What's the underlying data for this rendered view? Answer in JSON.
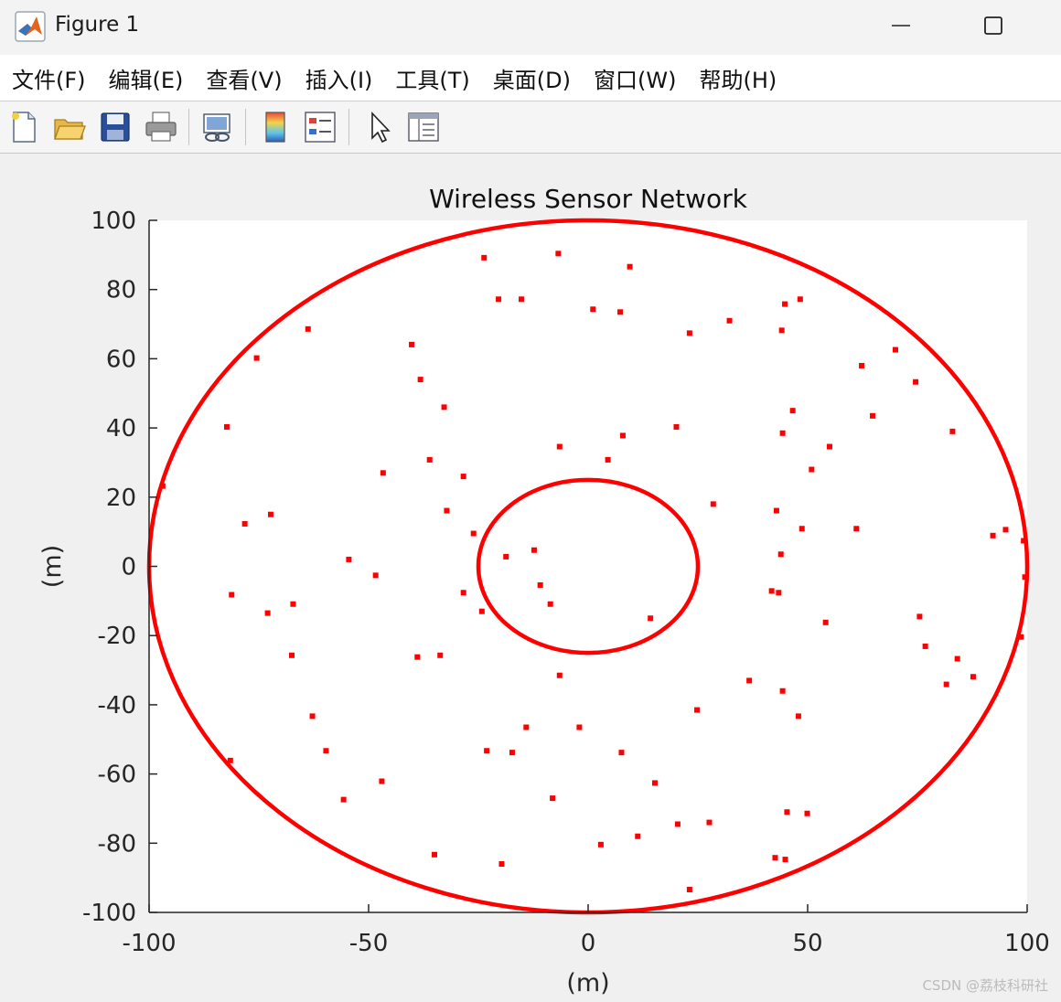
{
  "window": {
    "title": "Figure 1",
    "minimize_icon": "minimize-icon",
    "maximize_icon": "maximize-icon"
  },
  "menu": [
    "文件(F)",
    "编辑(E)",
    "查看(V)",
    "插入(I)",
    "工具(T)",
    "桌面(D)",
    "窗口(W)",
    "帮助(H)"
  ],
  "toolbar": [
    "new-figure-icon",
    "open-file-icon",
    "save-icon",
    "print-icon",
    "link-plot-icon",
    "colorbar-icon",
    "legend-icon",
    "pointer-icon",
    "property-inspector-icon"
  ],
  "watermark": "CSDN @荔枝科研社",
  "colors": {
    "series": "#ff0000",
    "axes": "#262626",
    "plot_bg": "#ffffff",
    "figure_bg": "#f0f0f0"
  },
  "chart_data": {
    "type": "scatter",
    "title": "Wireless Sensor Network",
    "xlabel": "(m)",
    "ylabel": "(m)",
    "xlim": [
      -100,
      100
    ],
    "ylim": [
      -100,
      100
    ],
    "xticks": [
      -100,
      -50,
      0,
      50,
      100
    ],
    "yticks": [
      -100,
      -80,
      -60,
      -40,
      -20,
      0,
      20,
      40,
      60,
      80,
      100
    ],
    "grid": false,
    "circles": [
      {
        "cx": 0,
        "cy": 0,
        "r": 100
      },
      {
        "cx": 0,
        "cy": 0,
        "r": 25
      }
    ],
    "points": [
      [
        -23.7,
        89.2
      ],
      [
        -6.8,
        90.4
      ],
      [
        9.5,
        86.6
      ],
      [
        -20.4,
        77.2
      ],
      [
        -15.2,
        77.2
      ],
      [
        1.1,
        74.3
      ],
      [
        7.3,
        73.5
      ],
      [
        44.8,
        75.8
      ],
      [
        48.3,
        77.2
      ],
      [
        -63.8,
        68.6
      ],
      [
        -40.2,
        64.1
      ],
      [
        23.1,
        67.4
      ],
      [
        32.2,
        71.0
      ],
      [
        44.1,
        68.2
      ],
      [
        -75.5,
        60.2
      ],
      [
        -38.2,
        54.0
      ],
      [
        62.3,
        58.0
      ],
      [
        70.0,
        62.6
      ],
      [
        74.6,
        53.3
      ],
      [
        -32.8,
        46.0
      ],
      [
        46.6,
        45.0
      ],
      [
        64.8,
        43.5
      ],
      [
        -82.3,
        40.3
      ],
      [
        20.1,
        40.3
      ],
      [
        7.9,
        37.8
      ],
      [
        44.3,
        38.5
      ],
      [
        83.0,
        39.0
      ],
      [
        -6.5,
        34.6
      ],
      [
        -36.1,
        30.8
      ],
      [
        4.5,
        30.8
      ],
      [
        55.0,
        34.6
      ],
      [
        -46.7,
        27.0
      ],
      [
        -28.4,
        26.0
      ],
      [
        50.9,
        28.0
      ],
      [
        -96.9,
        23.2
      ],
      [
        28.5,
        18.0
      ],
      [
        -78.2,
        12.3
      ],
      [
        -72.3,
        15.0
      ],
      [
        -32.2,
        16.1
      ],
      [
        42.9,
        16.1
      ],
      [
        -26.1,
        9.5
      ],
      [
        48.7,
        10.9
      ],
      [
        61.1,
        10.9
      ],
      [
        92.2,
        8.9
      ],
      [
        95.1,
        10.6
      ],
      [
        99.2,
        7.4
      ],
      [
        -54.5,
        2.0
      ],
      [
        -18.7,
        2.8
      ],
      [
        -12.3,
        4.7
      ],
      [
        43.9,
        3.5
      ],
      [
        -48.4,
        -2.6
      ],
      [
        99.5,
        -3.1
      ],
      [
        -81.2,
        -8.2
      ],
      [
        -28.4,
        -7.6
      ],
      [
        -10.9,
        -5.4
      ],
      [
        41.8,
        -7.1
      ],
      [
        43.4,
        -7.6
      ],
      [
        -73.0,
        -13.5
      ],
      [
        -67.2,
        -10.9
      ],
      [
        -24.2,
        -13.0
      ],
      [
        -8.6,
        -10.9
      ],
      [
        14.2,
        -15.0
      ],
      [
        54.1,
        -16.2
      ],
      [
        75.5,
        -14.5
      ],
      [
        98.6,
        -20.4
      ],
      [
        76.8,
        -23.1
      ],
      [
        -67.5,
        -25.7
      ],
      [
        -38.9,
        -26.2
      ],
      [
        -33.7,
        -25.7
      ],
      [
        84.1,
        -26.7
      ],
      [
        -6.5,
        -31.5
      ],
      [
        36.7,
        -33.0
      ],
      [
        81.6,
        -34.1
      ],
      [
        87.7,
        -31.9
      ],
      [
        44.3,
        -36.0
      ],
      [
        -62.8,
        -43.3
      ],
      [
        24.8,
        -41.5
      ],
      [
        47.9,
        -43.3
      ],
      [
        -14.1,
        -46.5
      ],
      [
        -2.0,
        -46.5
      ],
      [
        -81.5,
        -56.1
      ],
      [
        -59.7,
        -53.3
      ],
      [
        -23.1,
        -53.3
      ],
      [
        -17.3,
        -53.8
      ],
      [
        7.6,
        -53.8
      ],
      [
        -47.0,
        -62.1
      ],
      [
        15.2,
        -62.6
      ],
      [
        -55.7,
        -67.4
      ],
      [
        -8.1,
        -67.0
      ],
      [
        45.3,
        -71.0
      ],
      [
        49.9,
        -71.4
      ],
      [
        11.3,
        -78.0
      ],
      [
        20.4,
        -74.5
      ],
      [
        27.6,
        -74.0
      ],
      [
        -35.0,
        -83.3
      ],
      [
        2.9,
        -80.4
      ],
      [
        42.6,
        -84.2
      ],
      [
        44.9,
        -84.7
      ],
      [
        -19.7,
        -86.0
      ],
      [
        23.1,
        -93.4
      ]
    ]
  }
}
